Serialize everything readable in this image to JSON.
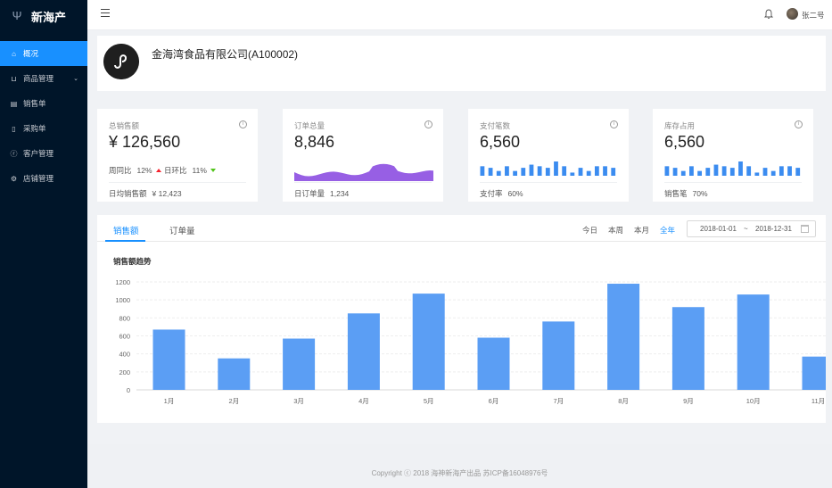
{
  "brand": {
    "name": "新海产"
  },
  "sidebar": {
    "items": [
      {
        "label": "概况",
        "icon": "home-icon",
        "active": true
      },
      {
        "label": "商品管理",
        "icon": "cart-icon",
        "hasArrow": true
      },
      {
        "label": "销售单",
        "icon": "document-icon"
      },
      {
        "label": "采购单",
        "icon": "file-icon"
      },
      {
        "label": "客户管理",
        "icon": "user-icon"
      },
      {
        "label": "店铺管理",
        "icon": "settings-icon"
      }
    ]
  },
  "header": {
    "username": "张二号"
  },
  "company": {
    "name": "金海湾食品有限公司(A100002)"
  },
  "stats": {
    "sales": {
      "label": "总销售额",
      "value": "¥ 126,560",
      "wow_label": "周同比",
      "wow_value": "12%",
      "dod_label": "日环比",
      "dod_value": "11%",
      "footer_label": "日均销售额",
      "footer_value": "¥ 12,423"
    },
    "orders": {
      "label": "订单总量",
      "value": "8,846",
      "footer_label": "日订单量",
      "footer_value": "1,234"
    },
    "payments": {
      "label": "支付笔数",
      "value": "6,560",
      "footer_label": "支付率",
      "footer_value": "60%"
    },
    "inventory": {
      "label": "库存占用",
      "value": "6,560",
      "footer_label": "销售笔",
      "footer_value": "70%"
    }
  },
  "sales_panel": {
    "tabs": [
      "销售额",
      "订单量"
    ],
    "ranges": [
      "今日",
      "本周",
      "本月",
      "全年"
    ],
    "active_range": "全年",
    "date_start": "2018-01-01",
    "date_separator": "~",
    "date_end": "2018-12-31",
    "chart_title": "销售额趋势"
  },
  "chart_data": {
    "type": "bar",
    "title": "销售额趋势",
    "categories": [
      "1月",
      "2月",
      "3月",
      "4月",
      "5月",
      "6月",
      "7月",
      "8月",
      "9月",
      "10月",
      "11月"
    ],
    "values": [
      670,
      350,
      570,
      850,
      1070,
      580,
      760,
      1180,
      920,
      1060,
      370
    ],
    "ylim": [
      0,
      1200
    ],
    "yticks": [
      0,
      200,
      400,
      600,
      800,
      1000,
      1200
    ],
    "grid": true,
    "color": "#5b9ef4"
  },
  "mini_area": {
    "color": "#975fe4"
  },
  "mini_bars_payments": {
    "values": [
      6,
      5,
      3,
      6,
      3,
      5,
      7,
      6,
      5,
      9,
      6,
      2,
      5,
      3,
      6,
      6,
      5
    ],
    "color": "#3b8cf0"
  },
  "mini_bars_inventory": {
    "values": [
      6,
      5,
      3,
      6,
      3,
      5,
      7,
      6,
      5,
      9,
      6,
      2,
      5,
      3,
      6,
      6,
      5
    ],
    "color": "#3b8cf0"
  },
  "footer": {
    "text": "Copyright ⓒ 2018 海神新海产出品 苏ICP备16048976号"
  }
}
